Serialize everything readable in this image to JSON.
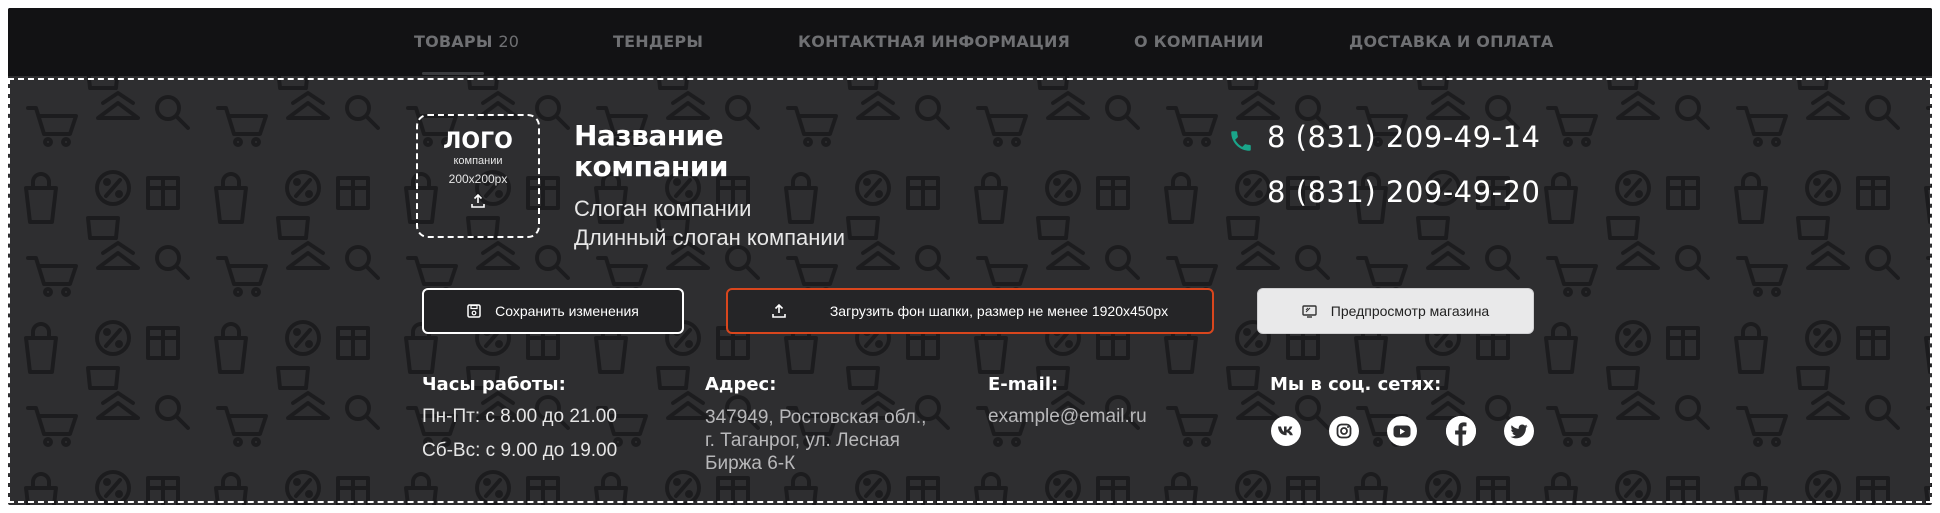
{
  "nav": {
    "items": [
      {
        "label": "ТОВАРЫ",
        "count": "20"
      },
      {
        "label": "ТЕНДЕРЫ"
      },
      {
        "label": "КОНТАКТНАЯ ИНФОРМАЦИЯ"
      },
      {
        "label": "О КОМПАНИИ"
      },
      {
        "label": "ДОСТАВКА И ОПЛАТА"
      }
    ]
  },
  "logo": {
    "title": "ЛОГО",
    "subtitle": "компании",
    "size": "200x200px",
    "icon": "upload-icon"
  },
  "company": {
    "name": "Название компании",
    "slogan": "Слоган компании",
    "long_slogan": "Длинный слоган компании"
  },
  "phones": [
    "8 (831) 209-49-14",
    "8 (831) 209-49-20"
  ],
  "buttons": {
    "save": "Сохранить изменения",
    "upload": "Загрузить фон шапки, размер не менее 1920x450px",
    "preview": "Предпросмотр магазина"
  },
  "info": {
    "hours_title": "Часы работы:",
    "hours": [
      "Пн-Пт: с 8.00 до 21.00",
      "Сб-Вс: с 9.00 до 19.00"
    ],
    "address_title": "Адрес:",
    "address": [
      "347949, Ростовская обл.,",
      "г. Таганрог, ул. Лесная",
      "Биржа 6-К"
    ],
    "email_title": "E-mail:",
    "email": "example@email.ru",
    "social_title": "Мы в соц. сетях:",
    "social": [
      "vk-icon",
      "instagram-icon",
      "youtube-icon",
      "facebook-icon",
      "twitter-icon"
    ]
  },
  "colors": {
    "accent": "#d9461d",
    "phone_icon": "#1aa58a",
    "background": "#2e2e30",
    "nav": "#121214"
  }
}
